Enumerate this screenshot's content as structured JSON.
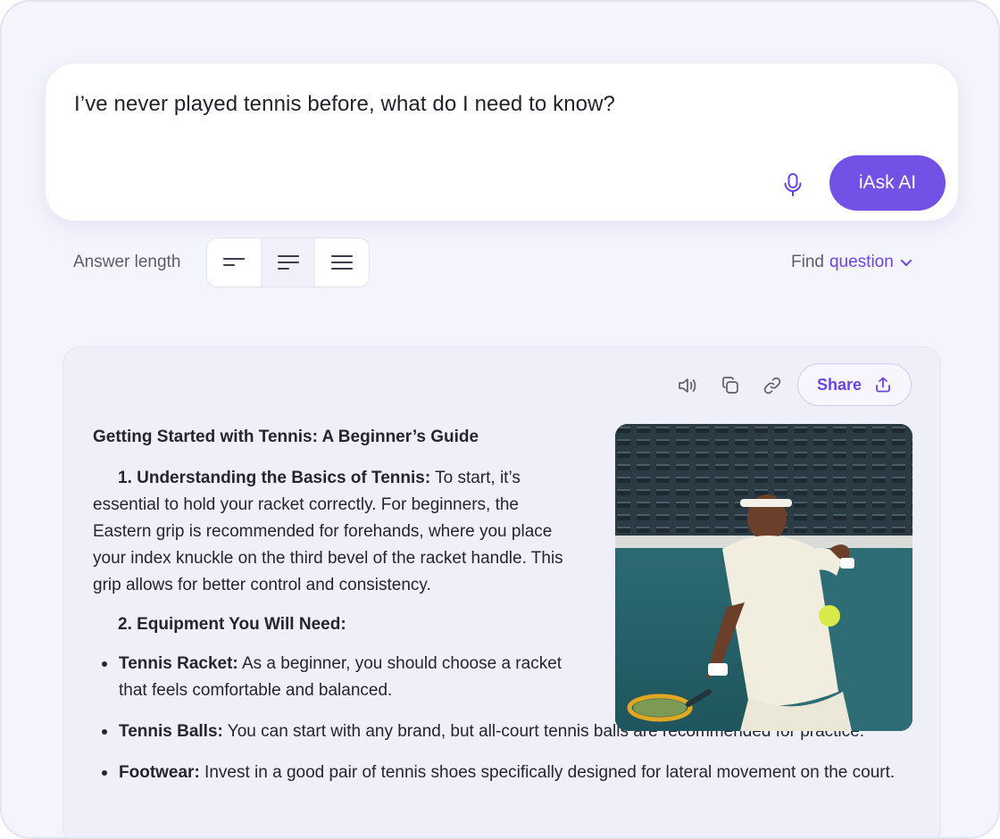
{
  "search": {
    "query": "I’ve never played tennis before, what do I need to know?",
    "submit_label": "iAsk AI",
    "mic_icon": "microphone-icon"
  },
  "answer_length": {
    "label": "Answer length",
    "options": [
      "short",
      "medium",
      "long"
    ],
    "selected": "medium"
  },
  "find_question": {
    "prefix": "Find",
    "accent": "question"
  },
  "toolbar": {
    "icons": [
      "speaker-icon",
      "copy-icon",
      "link-icon"
    ],
    "share_label": "Share"
  },
  "answer": {
    "title": "Getting Started with Tennis: A Beginner’s Guide",
    "section1_heading": "1. Understanding the Basics of Tennis:",
    "section1_text": " To start, it’s essential to hold your racket correctly. For beginners, the Eastern grip is recommended for forehands, where you place your index knuckle on the third bevel of the racket handle. This grip allows for better control and consistency.",
    "section2_heading": "2. Equipment You Will Need:",
    "bullets": [
      {
        "term": "Tennis Racket:",
        "text": " As a beginner, you should choose a racket that feels comfortable and balanced."
      },
      {
        "term": "Tennis Balls:",
        "text": " You can start with any brand, but all-court tennis balls are recommended for practice."
      },
      {
        "term": "Footwear:",
        "text": " Invest in a good pair of tennis shoes specifically designed for lateral movement on the court."
      }
    ]
  },
  "colors": {
    "accent": "#7350e6",
    "page_bg": "#f4f4fd",
    "card_bg": "#efeff9"
  }
}
